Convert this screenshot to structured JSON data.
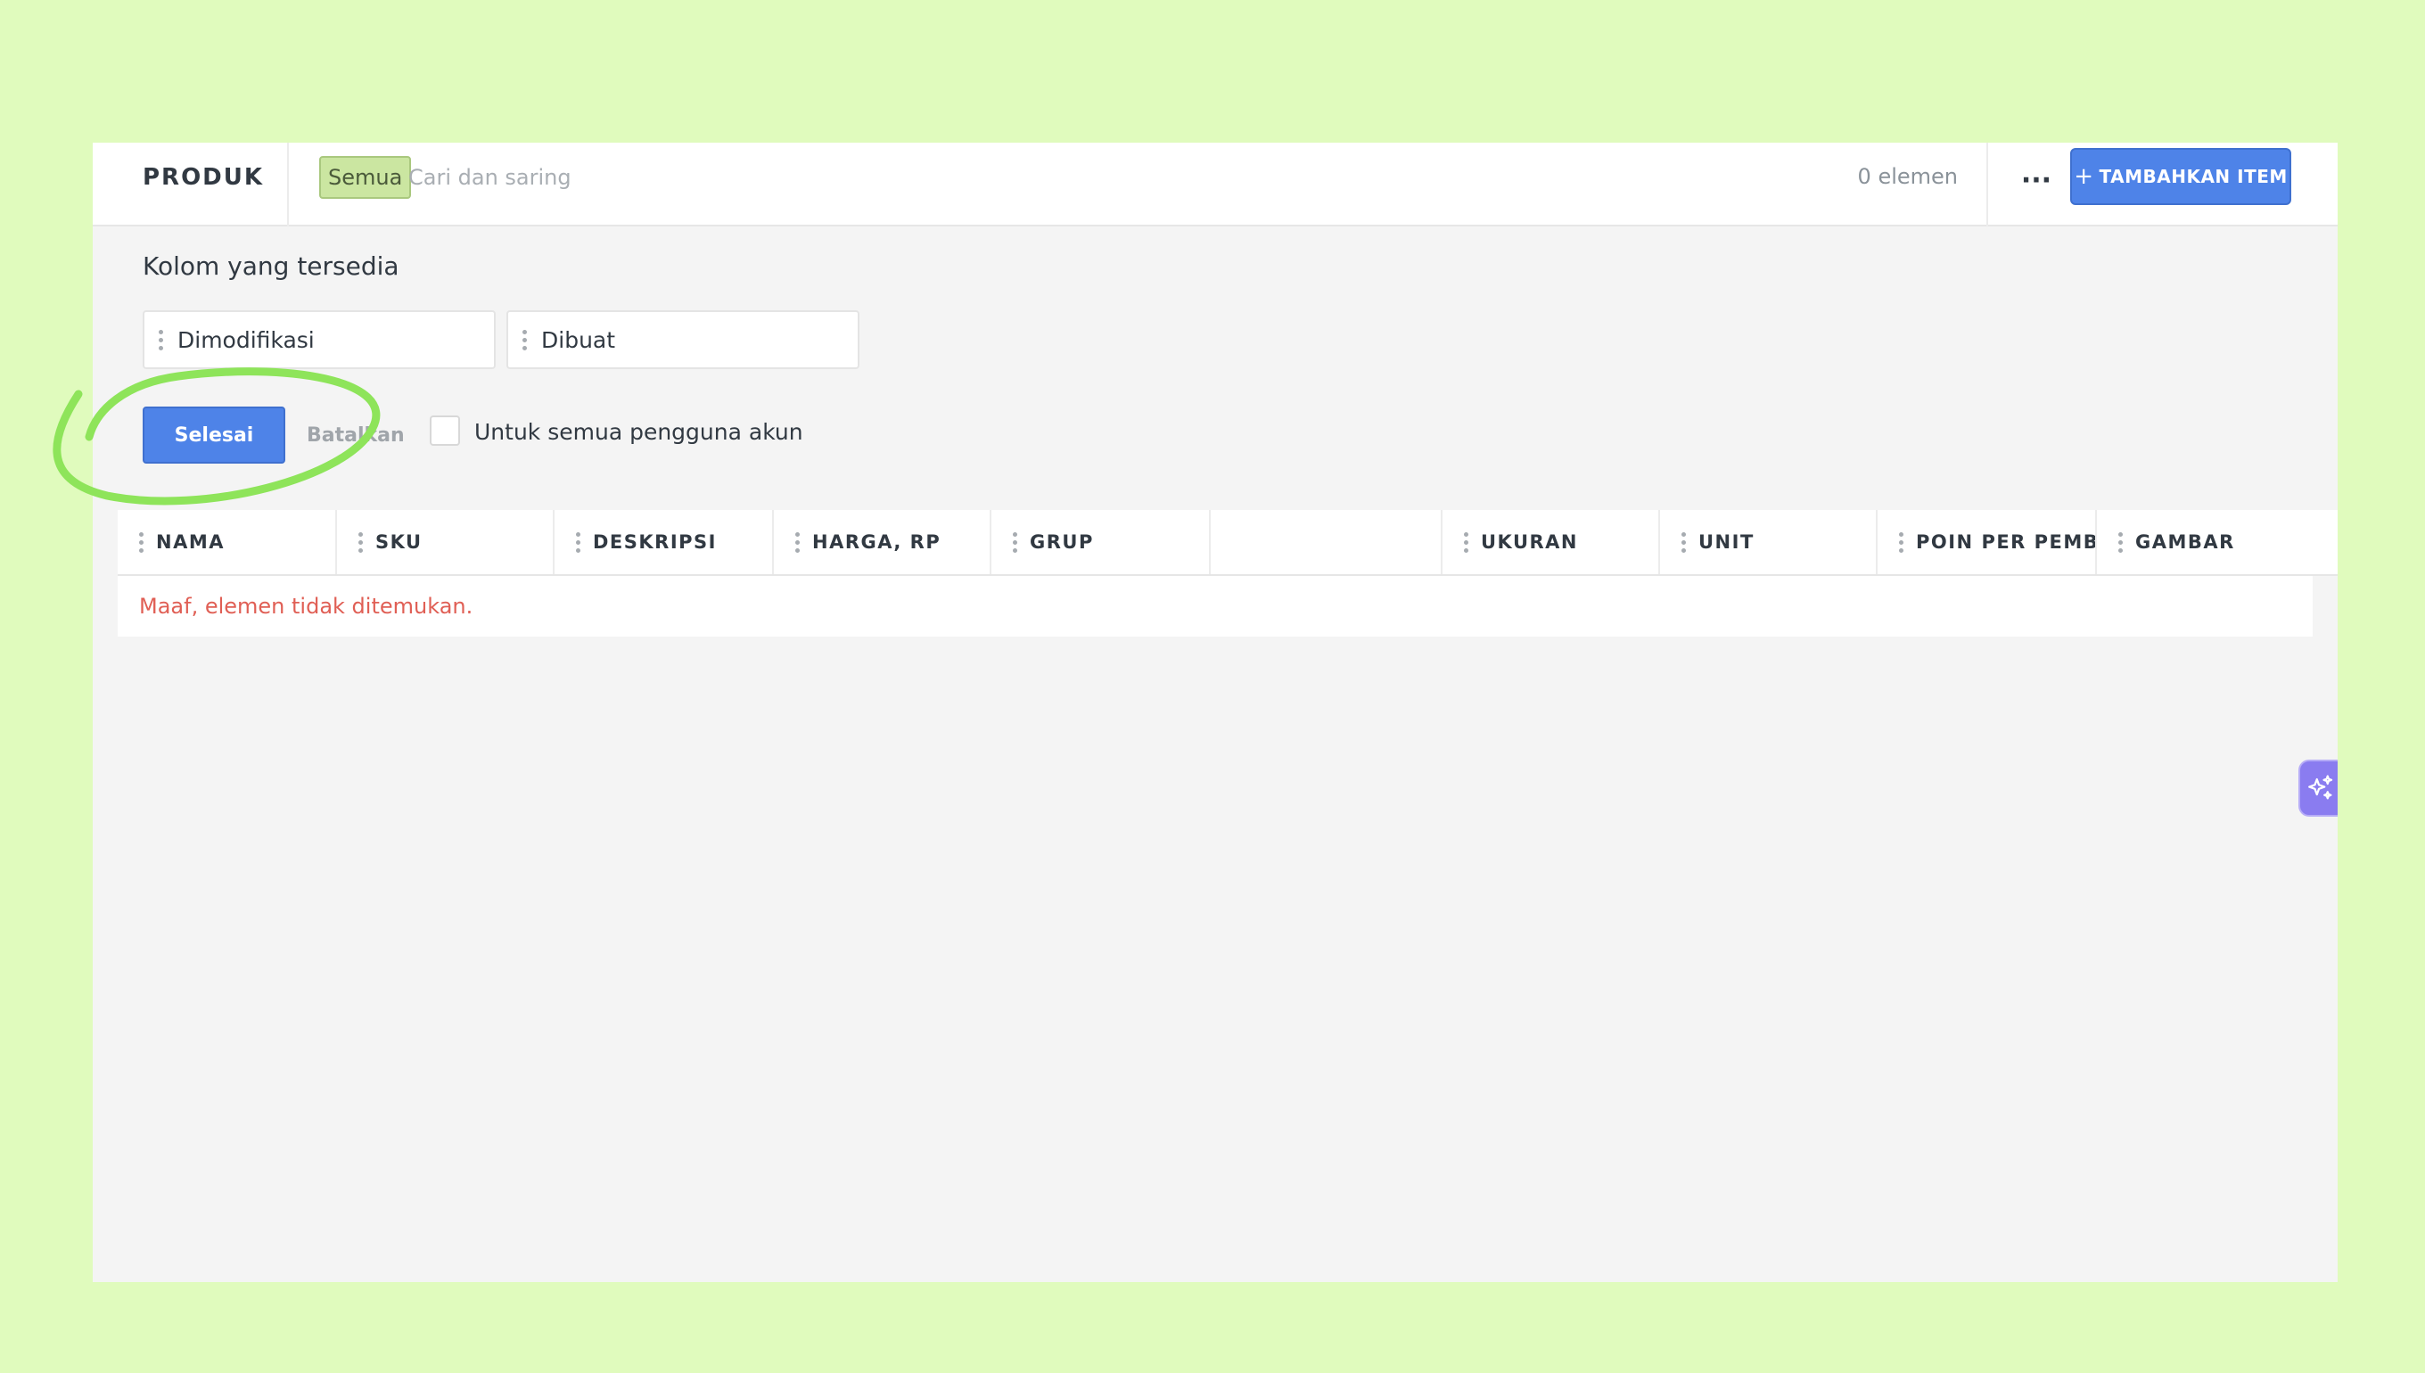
{
  "header": {
    "title": "PRODUK",
    "filter_tag": "Semua",
    "search_placeholder": "Cari dan saring",
    "count": "0 elemen",
    "more_label": "···",
    "add_button": "TAMBAHKAN ITEM"
  },
  "panel": {
    "heading": "Kolom yang tersedia",
    "available_columns": [
      "Dimodifikasi",
      "Dibuat"
    ],
    "done_button": "Selesai",
    "cancel_button": "Batalkan",
    "all_users_label": "Untuk semua pengguna akun",
    "all_users_checked": false
  },
  "table": {
    "columns": [
      "NAMA",
      "SKU",
      "DESKRIPSI",
      "HARGA, RP",
      "GRUP",
      "",
      "UKURAN",
      "UNIT",
      "POIN PER PEMBELIAN",
      "GAMBAR"
    ],
    "empty_message": "Maaf, elemen tidak ditemukan."
  },
  "colors": {
    "background": "#e0fbbd",
    "accent": "#4e83e8",
    "tag": "#cbe6a1",
    "error_text": "#e05f55",
    "annotation": "#8ee45a",
    "ai_button": "#8a7cf0"
  },
  "icons": {
    "drag_handle": "drag-handle-icon",
    "more": "more-horizontal-icon",
    "plus": "plus-icon",
    "ai": "sparkles-icon"
  }
}
